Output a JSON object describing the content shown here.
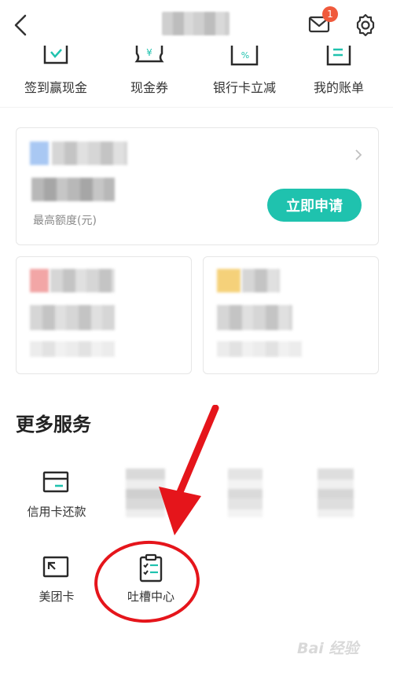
{
  "header": {
    "title": "",
    "mail_badge": "1"
  },
  "quick_actions": [
    {
      "label": "签到赢现金",
      "icon": "check-box-icon"
    },
    {
      "label": "现金券",
      "icon": "yen-coupon-icon"
    },
    {
      "label": "银行卡立减",
      "icon": "percent-card-icon"
    },
    {
      "label": "我的账单",
      "icon": "bill-icon"
    }
  ],
  "loan_card": {
    "amount": "",
    "limit_label": "最高额度(元)",
    "apply_label": "立即申请"
  },
  "more_services": {
    "title": "更多服务",
    "items": [
      {
        "label": "信用卡还款",
        "icon": "credit-card-repay-icon"
      },
      {
        "label": "",
        "icon": ""
      },
      {
        "label": "",
        "icon": ""
      },
      {
        "label": "",
        "icon": ""
      },
      {
        "label": "美团卡",
        "icon": "meituan-card-icon"
      },
      {
        "label": "吐槽中心",
        "icon": "feedback-clipboard-icon"
      }
    ]
  },
  "watermark": "Bai 经验",
  "colors": {
    "accent": "#1fc2ae",
    "badge": "#f05a3c",
    "annotation": "#e5151b"
  }
}
